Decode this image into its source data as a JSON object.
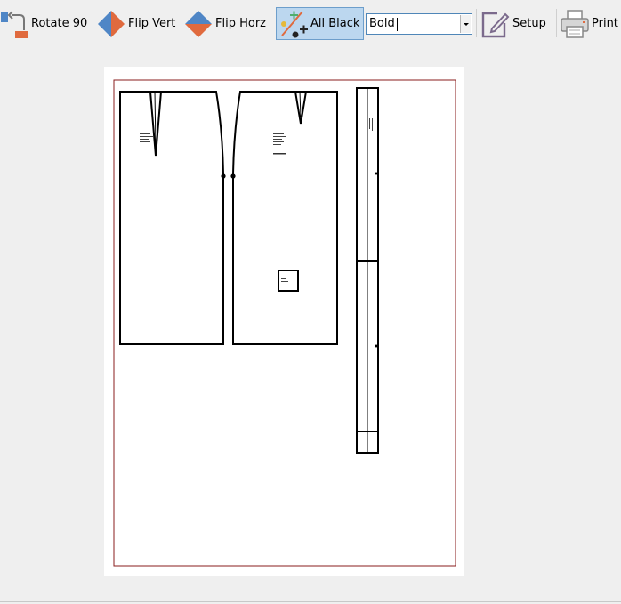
{
  "toolbar": {
    "rotate_label": "Rotate 90",
    "flip_vert_label": "Flip Vert",
    "flip_horz_label": "Flip Horz",
    "all_black_label": "All Black",
    "line_style": {
      "value": "Bold"
    },
    "setup_label": "Setup",
    "print_label": "Print"
  },
  "colors": {
    "accent_blue": "#4f86c6",
    "accent_orange": "#e06a3e",
    "toggle_active": "#bcd7ef",
    "frame": "#8a1c1c"
  },
  "icons": {
    "rotate": "rotate-icon",
    "flip_vert": "flip-vertical-icon",
    "flip_horz": "flip-horizontal-icon",
    "all_black": "color-to-black-icon",
    "setup": "edit-setup-icon",
    "print": "printer-icon"
  }
}
